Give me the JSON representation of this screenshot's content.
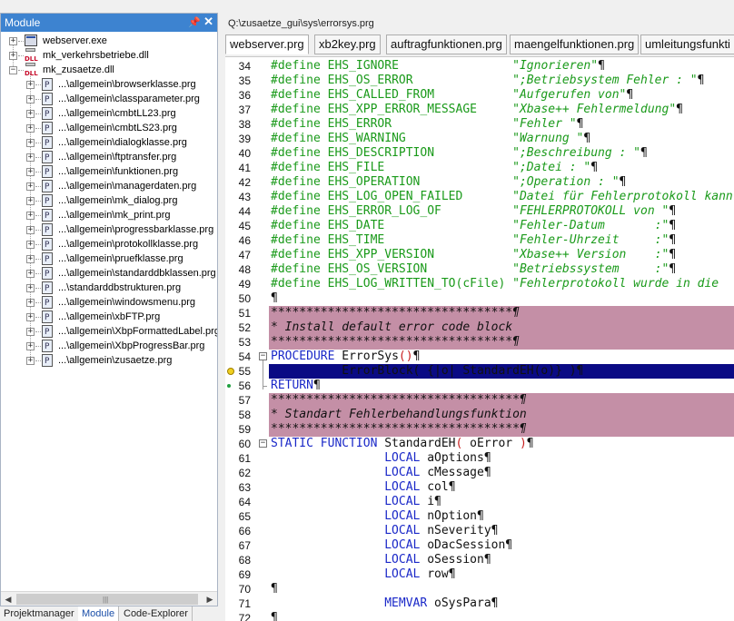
{
  "module_panel": {
    "title": "Module",
    "pin_glyph": "📌",
    "close_glyph": "✕",
    "tree": [
      {
        "label": "webserver.exe",
        "icon": "exe-icon",
        "expander": "+"
      },
      {
        "label": "mk_verkehrsbetriebe.dll",
        "icon": "dll-icon",
        "expander": "+"
      },
      {
        "label": "mk_zusaetze.dll",
        "icon": "dll-icon",
        "expander": "−"
      },
      {
        "label": "...\\allgemein\\browserklasse.prg",
        "icon": "prg-icon",
        "expander": "+"
      },
      {
        "label": "...\\allgemein\\classparameter.prg",
        "icon": "prg-icon",
        "expander": "+"
      },
      {
        "label": "...\\allgemein\\cmbtLL23.prg",
        "icon": "prg-icon",
        "expander": "+"
      },
      {
        "label": "...\\allgemein\\cmbtLS23.prg",
        "icon": "prg-icon",
        "expander": "+"
      },
      {
        "label": "...\\allgemein\\dialogklasse.prg",
        "icon": "prg-icon",
        "expander": "+"
      },
      {
        "label": "...\\allgemein\\ftptransfer.prg",
        "icon": "prg-icon",
        "expander": "+"
      },
      {
        "label": "...\\allgemein\\funktionen.prg",
        "icon": "prg-icon",
        "expander": "+"
      },
      {
        "label": "...\\allgemein\\managerdaten.prg",
        "icon": "prg-icon",
        "expander": "+"
      },
      {
        "label": "...\\allgemein\\mk_dialog.prg",
        "icon": "prg-icon",
        "expander": "+"
      },
      {
        "label": "...\\allgemein\\mk_print.prg",
        "icon": "prg-icon",
        "expander": "+"
      },
      {
        "label": "...\\allgemein\\progressbarklasse.prg",
        "icon": "prg-icon",
        "expander": "+"
      },
      {
        "label": "...\\allgemein\\protokollklasse.prg",
        "icon": "prg-icon",
        "expander": "+"
      },
      {
        "label": "...\\allgemein\\pruefklasse.prg",
        "icon": "prg-icon",
        "expander": "+"
      },
      {
        "label": "...\\allgemein\\standarddbklassen.prg",
        "icon": "prg-icon",
        "expander": "+"
      },
      {
        "label": "...\\standarddbstrukturen.prg",
        "icon": "prg-icon",
        "expander": "+"
      },
      {
        "label": "...\\allgemein\\windowsmenu.prg",
        "icon": "prg-icon",
        "expander": "+"
      },
      {
        "label": "...\\allgemein\\xbFTP.prg",
        "icon": "prg-icon",
        "expander": "+"
      },
      {
        "label": "...\\allgemein\\XbpFormattedLabel.prg",
        "icon": "prg-icon",
        "expander": "+"
      },
      {
        "label": "...\\allgemein\\XbpProgressBar.prg",
        "icon": "prg-icon",
        "expander": "+"
      },
      {
        "label": "...\\allgemein\\zusaetze.prg",
        "icon": "prg-icon",
        "expander": "+"
      }
    ],
    "hscroll": {
      "left": "◀",
      "right": "▶",
      "grip": "|||"
    },
    "bottom_tabs": [
      {
        "label": "Projektmanager",
        "active": false
      },
      {
        "label": "Module",
        "active": true
      },
      {
        "label": "Code-Explorer",
        "active": false
      }
    ]
  },
  "editor": {
    "path": "Q:\\zusaetze_gui\\sys\\errorsys.prg",
    "tabs": [
      {
        "label": "webserver.prg",
        "active": true
      },
      {
        "label": "xb2key.prg",
        "active": false
      },
      {
        "label": "auftragfunktionen.prg",
        "active": false
      },
      {
        "label": "maengelfunktionen.prg",
        "active": false
      },
      {
        "label": "umleitungsfunkti",
        "active": false
      }
    ],
    "lines": [
      {
        "n": "34",
        "parts": [
          [
            "d",
            "#define "
          ],
          [
            "d",
            "EHS_IGNORE"
          ],
          [
            "s",
            "                \"Ignorieren\""
          ],
          [
            "p",
            "¶"
          ]
        ]
      },
      {
        "n": "35",
        "parts": [
          [
            "d",
            "#define "
          ],
          [
            "d",
            "EHS_OS_ERROR"
          ],
          [
            "s",
            "              \";Betriebsystem Fehler : \""
          ],
          [
            "p",
            "¶"
          ]
        ]
      },
      {
        "n": "36",
        "parts": [
          [
            "d",
            "#define "
          ],
          [
            "d",
            "EHS_CALLED_FROM"
          ],
          [
            "s",
            "           \"Aufgerufen von\""
          ],
          [
            "p",
            "¶"
          ]
        ]
      },
      {
        "n": "37",
        "parts": [
          [
            "d",
            "#define "
          ],
          [
            "d",
            "EHS_XPP_ERROR_MESSAGE"
          ],
          [
            "s",
            "     \"Xbase++ Fehlermeldung\""
          ],
          [
            "p",
            "¶"
          ]
        ]
      },
      {
        "n": "38",
        "parts": [
          [
            "d",
            "#define "
          ],
          [
            "d",
            "EHS_ERROR"
          ],
          [
            "s",
            "                 \"Fehler \""
          ],
          [
            "p",
            "¶"
          ]
        ]
      },
      {
        "n": "39",
        "parts": [
          [
            "d",
            "#define "
          ],
          [
            "d",
            "EHS_WARNING"
          ],
          [
            "s",
            "               \"Warnung \""
          ],
          [
            "p",
            "¶"
          ]
        ]
      },
      {
        "n": "40",
        "parts": [
          [
            "d",
            "#define "
          ],
          [
            "d",
            "EHS_DESCRIPTION"
          ],
          [
            "s",
            "           \";Beschreibung : \""
          ],
          [
            "p",
            "¶"
          ]
        ]
      },
      {
        "n": "41",
        "parts": [
          [
            "d",
            "#define "
          ],
          [
            "d",
            "EHS_FILE"
          ],
          [
            "s",
            "                  \";Datei : \""
          ],
          [
            "p",
            "¶"
          ]
        ]
      },
      {
        "n": "42",
        "parts": [
          [
            "d",
            "#define "
          ],
          [
            "d",
            "EHS_OPERATION"
          ],
          [
            "s",
            "             \";Operation : \""
          ],
          [
            "p",
            "¶"
          ]
        ]
      },
      {
        "n": "43",
        "parts": [
          [
            "d",
            "#define "
          ],
          [
            "d",
            "EHS_LOG_OPEN_FAILED"
          ],
          [
            "s",
            "       \"Datei für Fehlerprotokoll kann ni"
          ]
        ]
      },
      {
        "n": "44",
        "parts": [
          [
            "d",
            "#define "
          ],
          [
            "d",
            "EHS_ERROR_LOG_OF"
          ],
          [
            "s",
            "          \"FEHLERPROTOKOLL von \""
          ],
          [
            "p",
            "¶"
          ]
        ]
      },
      {
        "n": "45",
        "parts": [
          [
            "d",
            "#define "
          ],
          [
            "d",
            "EHS_DATE"
          ],
          [
            "s",
            "                  \"Fehler-Datum       :\""
          ],
          [
            "p",
            "¶"
          ]
        ]
      },
      {
        "n": "46",
        "parts": [
          [
            "d",
            "#define "
          ],
          [
            "d",
            "EHS_TIME"
          ],
          [
            "s",
            "                  \"Fehler-Uhrzeit     :\""
          ],
          [
            "p",
            "¶"
          ]
        ]
      },
      {
        "n": "47",
        "parts": [
          [
            "d",
            "#define "
          ],
          [
            "d",
            "EHS_XPP_VERSION"
          ],
          [
            "s",
            "           \"Xbase++ Version    :\""
          ],
          [
            "p",
            "¶"
          ]
        ]
      },
      {
        "n": "48",
        "parts": [
          [
            "d",
            "#define "
          ],
          [
            "d",
            "EHS_OS_VERSION"
          ],
          [
            "s",
            "            \"Betriebssystem     :\""
          ],
          [
            "p",
            "¶"
          ]
        ]
      },
      {
        "n": "49",
        "parts": [
          [
            "d",
            "#define "
          ],
          [
            "d",
            "EHS_LOG_WRITTEN_TO(cFile)"
          ],
          [
            "s",
            " \"Fehlerprotokoll wurde in die "
          ]
        ]
      },
      {
        "n": "50",
        "parts": [
          [
            "p",
            "¶"
          ]
        ]
      },
      {
        "n": "51",
        "style": "comment",
        "parts": [
          [
            "c",
            "**********************************¶"
          ]
        ]
      },
      {
        "n": "52",
        "style": "comment",
        "parts": [
          [
            "c",
            "* Install default error code block"
          ]
        ]
      },
      {
        "n": "53",
        "style": "comment",
        "parts": [
          [
            "c",
            "**********************************¶"
          ]
        ]
      },
      {
        "n": "54",
        "fold": "−",
        "parts": [
          [
            "k",
            "PROCEDURE "
          ],
          [
            "i",
            "ErrorSys"
          ],
          [
            "r",
            "()"
          ],
          [
            "p",
            "¶"
          ]
        ]
      },
      {
        "n": "55",
        "style": "exec",
        "marker": "arrow",
        "parts": [
          [
            "i",
            "          ErrorBlock( {|o| StandardEH(o)} )¶"
          ]
        ]
      },
      {
        "n": "56",
        "marker": "bp",
        "foldend": true,
        "parts": [
          [
            "k",
            "RETURN"
          ],
          [
            "p",
            "¶"
          ]
        ]
      },
      {
        "n": "57",
        "style": "comment",
        "parts": [
          [
            "c",
            "***********************************¶"
          ]
        ]
      },
      {
        "n": "58",
        "style": "comment",
        "parts": [
          [
            "c",
            "* Standart Fehlerbehandlungsfunktion"
          ]
        ]
      },
      {
        "n": "59",
        "style": "comment",
        "parts": [
          [
            "c",
            "***********************************¶"
          ]
        ]
      },
      {
        "n": "60",
        "fold": "−",
        "parts": [
          [
            "k",
            "STATIC FUNCTION "
          ],
          [
            "i",
            "StandardEH"
          ],
          [
            "r",
            "( "
          ],
          [
            "i",
            "oError "
          ],
          [
            "r",
            ")"
          ],
          [
            "p",
            "¶"
          ]
        ]
      },
      {
        "n": "61",
        "parts": [
          [
            "i",
            "                "
          ],
          [
            "k",
            "LOCAL "
          ],
          [
            "i",
            "aOptions"
          ],
          [
            "p",
            "¶"
          ]
        ]
      },
      {
        "n": "62",
        "parts": [
          [
            "i",
            "                "
          ],
          [
            "k",
            "LOCAL "
          ],
          [
            "i",
            "cMessage"
          ],
          [
            "p",
            "¶"
          ]
        ]
      },
      {
        "n": "63",
        "parts": [
          [
            "i",
            "                "
          ],
          [
            "k",
            "LOCAL "
          ],
          [
            "i",
            "col"
          ],
          [
            "p",
            "¶"
          ]
        ]
      },
      {
        "n": "64",
        "parts": [
          [
            "i",
            "                "
          ],
          [
            "k",
            "LOCAL "
          ],
          [
            "i",
            "i"
          ],
          [
            "p",
            "¶"
          ]
        ]
      },
      {
        "n": "65",
        "parts": [
          [
            "i",
            "                "
          ],
          [
            "k",
            "LOCAL "
          ],
          [
            "i",
            "nOption"
          ],
          [
            "p",
            "¶"
          ]
        ]
      },
      {
        "n": "66",
        "parts": [
          [
            "i",
            "                "
          ],
          [
            "k",
            "LOCAL "
          ],
          [
            "i",
            "nSeverity"
          ],
          [
            "p",
            "¶"
          ]
        ]
      },
      {
        "n": "67",
        "parts": [
          [
            "i",
            "                "
          ],
          [
            "k",
            "LOCAL "
          ],
          [
            "i",
            "oDacSession"
          ],
          [
            "p",
            "¶"
          ]
        ]
      },
      {
        "n": "68",
        "parts": [
          [
            "i",
            "                "
          ],
          [
            "k",
            "LOCAL "
          ],
          [
            "i",
            "oSession"
          ],
          [
            "p",
            "¶"
          ]
        ]
      },
      {
        "n": "69",
        "parts": [
          [
            "i",
            "                "
          ],
          [
            "k",
            "LOCAL "
          ],
          [
            "i",
            "row"
          ],
          [
            "p",
            "¶"
          ]
        ]
      },
      {
        "n": "70",
        "parts": [
          [
            "p",
            "¶"
          ]
        ]
      },
      {
        "n": "71",
        "parts": [
          [
            "i",
            "                "
          ],
          [
            "k",
            "MEMVAR "
          ],
          [
            "i",
            "oSysPara"
          ],
          [
            "p",
            "¶"
          ]
        ]
      },
      {
        "n": "72",
        "parts": [
          [
            "p",
            "¶"
          ]
        ]
      }
    ]
  },
  "colors": {
    "title_bar": "#3d83d0",
    "comment_bg": "#c48fa6",
    "exec_bg": "#0a0a84",
    "define": "#1a9a1a",
    "keyword": "#1a28c8",
    "paren": "#c81e1e"
  }
}
